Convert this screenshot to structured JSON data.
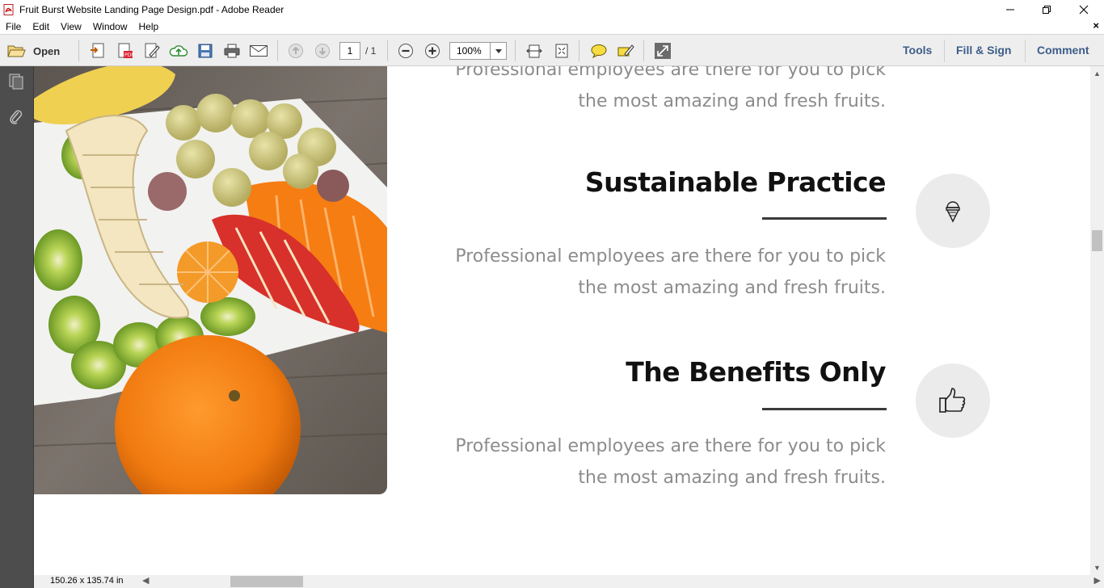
{
  "window": {
    "title": "Fruit Burst Website Landing Page Design.pdf - Adobe Reader",
    "minimize": "─",
    "restore": "❐",
    "close": "✕"
  },
  "menu": {
    "items": [
      "File",
      "Edit",
      "View",
      "Window",
      "Help"
    ],
    "doc_close": "×"
  },
  "toolbar": {
    "open_label": "Open",
    "page_current": "1",
    "page_total": "/ 1",
    "zoom": "100%",
    "tools_label": "Tools",
    "fill_sign_label": "Fill & Sign",
    "comment_label": "Comment"
  },
  "document": {
    "top_text_line1": "Professional employees are there for you to pick",
    "top_text_line2": "the most amazing and fresh fruits.",
    "section1": {
      "heading": "Sustainable Practice",
      "line1": "Professional employees are there for you to pick",
      "line2": "the most amazing and fresh fruits.",
      "icon": "ice-cream-icon"
    },
    "section2": {
      "heading": "The Benefits Only",
      "line1": "Professional employees are there for you to pick",
      "line2": "the most amazing and fresh fruits.",
      "icon": "thumbs-up-icon"
    }
  },
  "status": {
    "page_size": "150.26 x 135.74 in"
  },
  "colors": {
    "toolbar_bg": "#eeeeee",
    "left_panel": "#4d4d4d",
    "link_blue": "#3d5d8a",
    "body_text": "#8c8c8c",
    "icon_circle": "#ebebeb"
  }
}
